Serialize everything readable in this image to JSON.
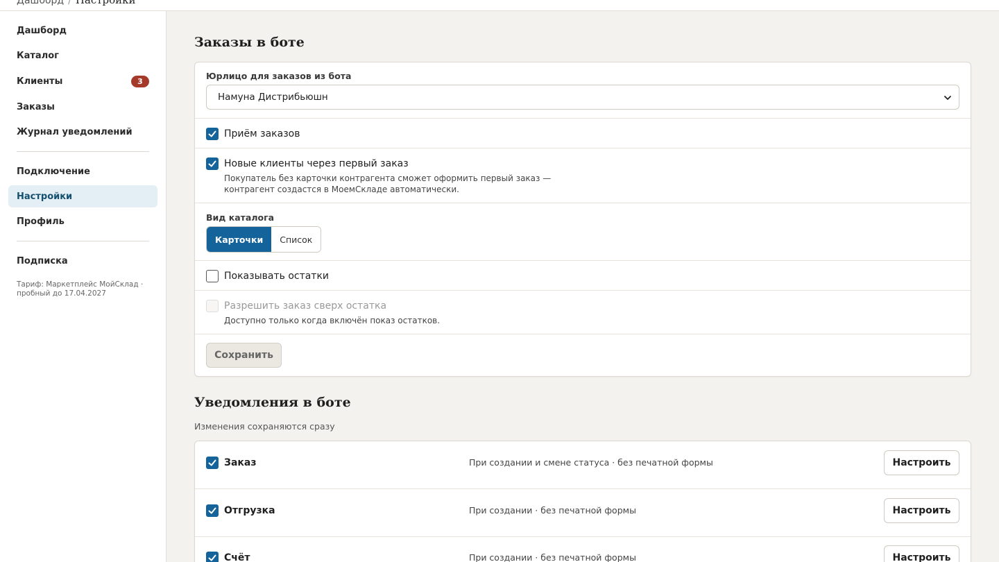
{
  "breadcrumb": {
    "parent": "Дашборд",
    "current": "Настройки"
  },
  "sidebar": {
    "items": [
      {
        "label": "Дашборд"
      },
      {
        "label": "Каталог"
      },
      {
        "label": "Клиенты",
        "badge": "3"
      },
      {
        "label": "Заказы"
      },
      {
        "label": "Журнал уведомлений"
      },
      {
        "label": "Подключение"
      },
      {
        "label": "Настройки",
        "active": true
      },
      {
        "label": "Профиль"
      },
      {
        "label": "Подписка"
      }
    ],
    "tariff": "Тариф: Маркетплейс МойСклад · пробный до 17.04.2027"
  },
  "orders": {
    "title": "Заказы в боте",
    "entity_label": "Юрлицо для заказов из бота",
    "entity_value": "Намуна Дистрибьюшн",
    "accept_orders": {
      "label": "Приём заказов",
      "checked": true
    },
    "new_clients": {
      "label": "Новые клиенты через первый заказ",
      "checked": true,
      "hint_line1": "Покупатель без карточки контрагента сможет оформить первый заказ —",
      "hint_line2": "контрагент создастся в МоемСкладе автоматически."
    },
    "catalog_view_label": "Вид каталога",
    "catalog_options": [
      "Карточки",
      "Список"
    ],
    "catalog_selected": "Карточки",
    "show_stock": {
      "label": "Показывать остатки",
      "checked": false
    },
    "allow_over_stock": {
      "label": "Разрешить заказ сверх остатка",
      "checked": false,
      "disabled": true,
      "hint": "Доступно только когда включён показ остатков."
    },
    "save_label": "Сохранить"
  },
  "notifications": {
    "title": "Уведомления в боте",
    "subtitle": "Изменения сохраняются сразу",
    "configure_label": "Настроить",
    "rows": [
      {
        "title": "Заказ",
        "desc": "При создании и смене статуса · без печатной формы",
        "checked": true
      },
      {
        "title": "Отгрузка",
        "desc": "При создании · без печатной формы",
        "checked": true
      },
      {
        "title": "Счёт",
        "desc": "При создании · без печатной формы",
        "checked": true
      }
    ]
  },
  "colors": {
    "accent": "#14639b",
    "badge": "#a53a2a",
    "active_nav_bg": "#e3eef5",
    "page_bg": "#f4f2ee"
  }
}
